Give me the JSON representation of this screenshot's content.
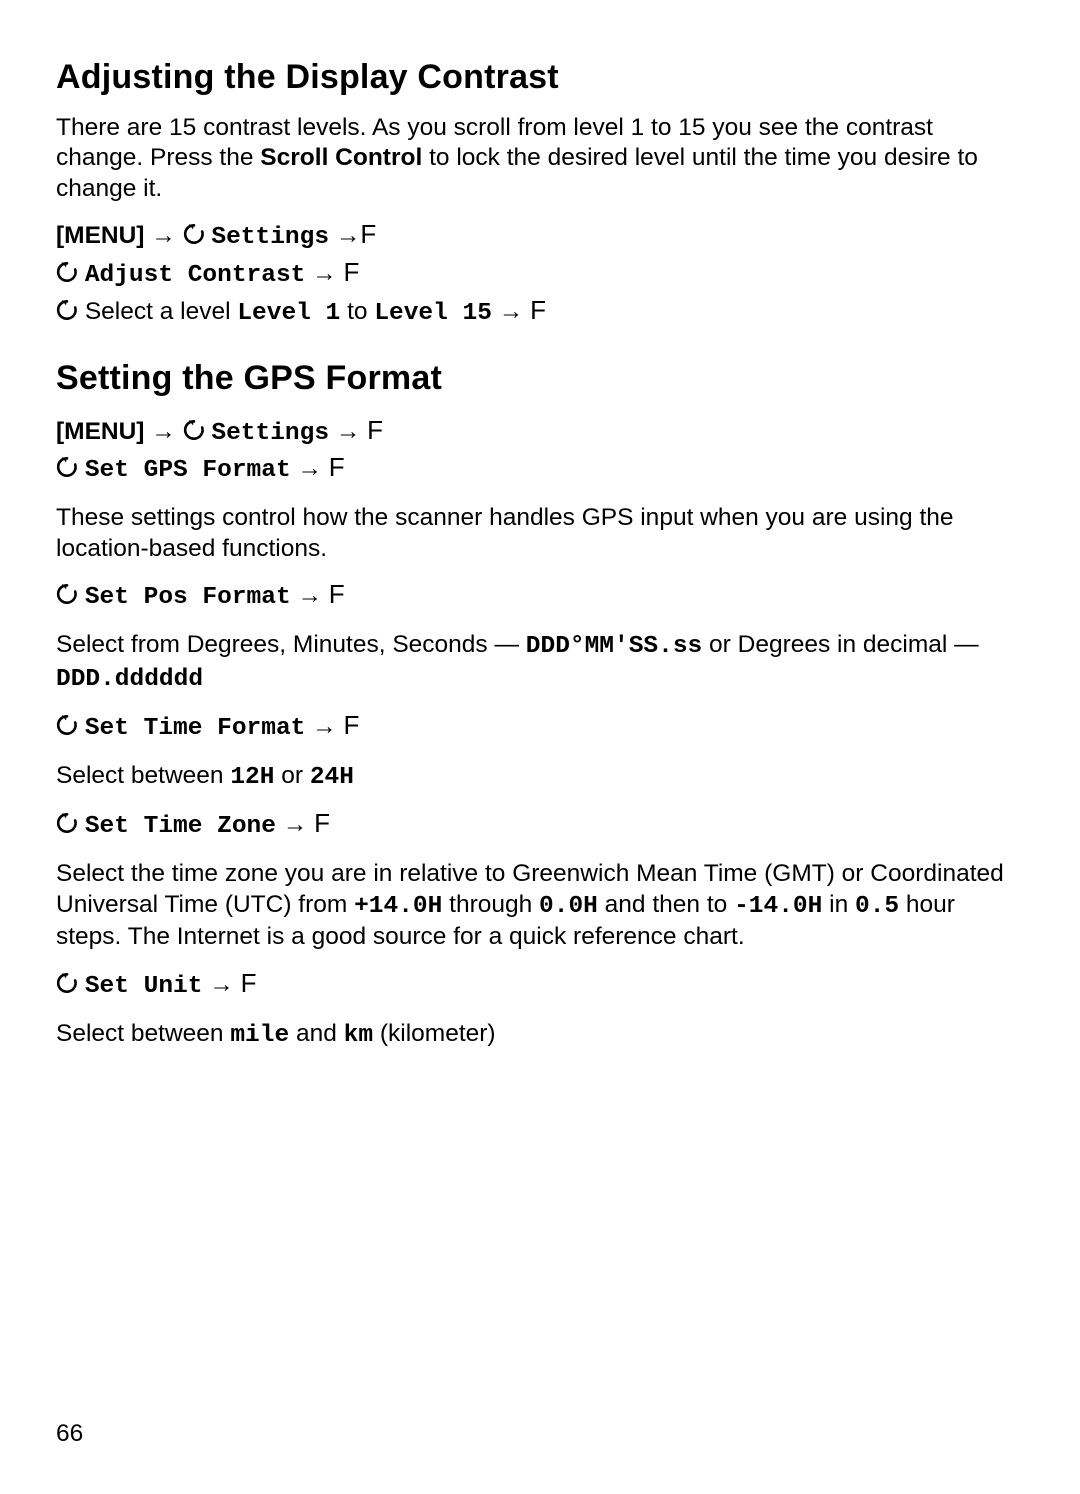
{
  "section1": {
    "heading": "Adjusting the Display Contrast",
    "intro_a": "There are 15 contrast levels. As you scroll from level 1 to 15 you see the contrast change. Press the ",
    "intro_bold": "Scroll Control",
    "intro_b": " to lock the desired level until the time you desire to change it.",
    "nav1_menu": "[MENU]",
    "nav1_settings": "Settings",
    "nav2_adjust": "Adjust Contrast",
    "nav3_a": "Select a level ",
    "nav3_lv1": "Level 1",
    "nav3_to": " to ",
    "nav3_lv15": "Level 15"
  },
  "section2": {
    "heading": "Setting the GPS Format",
    "nav1_menu": "[MENU]",
    "nav1_settings": "Settings",
    "nav2_setgps": "Set GPS Format",
    "desc": "These settings control how the scanner handles GPS input when you are using the location-based functions.",
    "setpos": "Set Pos Format",
    "pos_a": "Select from Degrees, Minutes, Seconds — ",
    "pos_mono1": "DDD°MM'SS.ss",
    "pos_b": " or Degrees in decimal — ",
    "pos_mono2": "DDD.dddddd",
    "settime": "Set Time Format",
    "time_a": "Select between ",
    "time_12": "12H",
    "time_or": " or ",
    "time_24": "24H",
    "setzone": "Set Time Zone",
    "zone_a": "Select the time zone you are in relative to Greenwich Mean Time (GMT) or Coordinated Universal Time (UTC) from ",
    "zone_p14": "+14.0H",
    "zone_b": " through ",
    "zone_0": "0.0H",
    "zone_c": " and then to ",
    "zone_m14": "-14.0H",
    "zone_d": " in ",
    "zone_step": "0.5",
    "zone_e": " hour steps. The Internet is a good source for a quick reference chart.",
    "setunit": "Set Unit",
    "unit_a": "Select between ",
    "unit_mile": "mile",
    "unit_and": " and ",
    "unit_km": "km",
    "unit_b": " (kilometer)"
  },
  "glyphs": {
    "arrow": "→",
    "f": "F"
  },
  "page_number": "66"
}
